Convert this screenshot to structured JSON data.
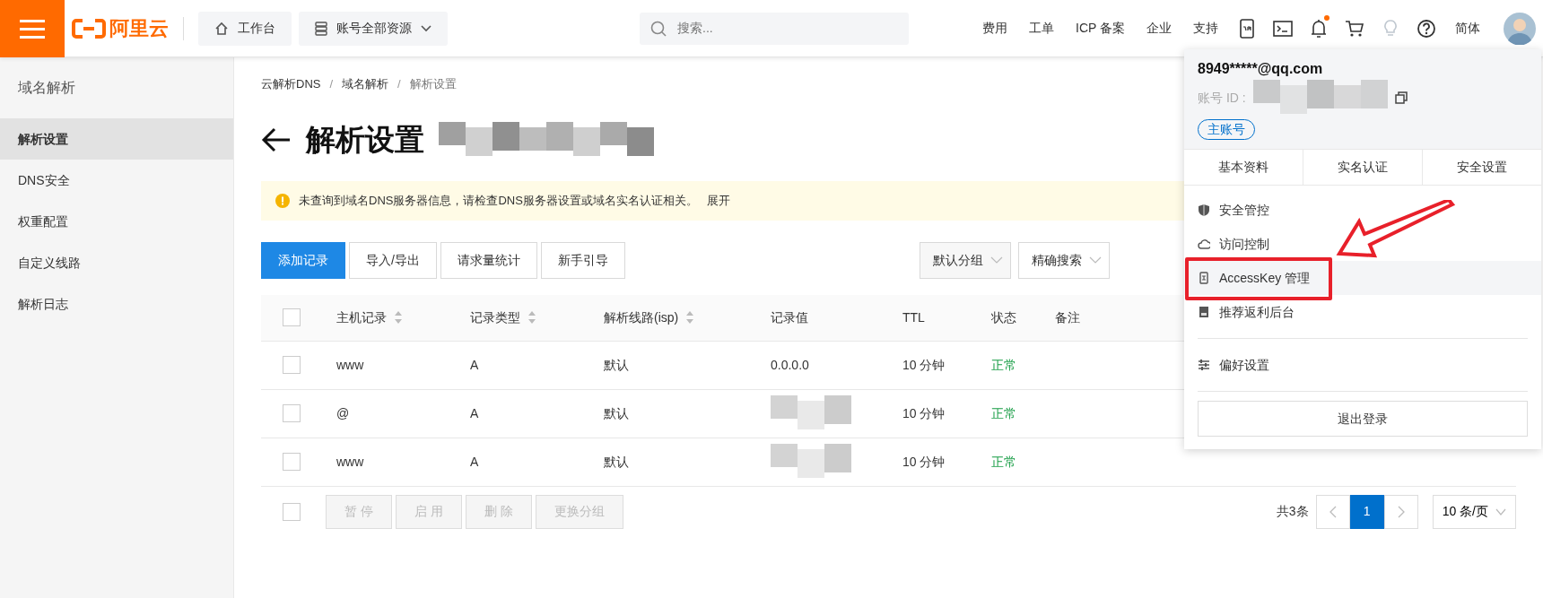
{
  "topbar": {
    "logo_text": "阿里云",
    "workbench": "工作台",
    "resources": "账号全部资源",
    "search_placeholder": "搜索...",
    "links": [
      "费用",
      "工单",
      "ICP 备案",
      "企业",
      "支持"
    ],
    "icons": [
      {
        "kind": "app",
        "dot": false,
        "dimmed": false
      },
      {
        "kind": "terminal",
        "dot": false,
        "dimmed": false
      },
      {
        "kind": "bell",
        "dot": true,
        "dimmed": false
      },
      {
        "kind": "cart",
        "dot": false,
        "dimmed": false
      },
      {
        "kind": "bulb",
        "dot": false,
        "dimmed": true
      },
      {
        "kind": "help",
        "dot": false,
        "dimmed": false
      }
    ],
    "language": "简体"
  },
  "sidebar": {
    "title": "域名解析",
    "items": [
      {
        "label": "解析设置",
        "selected": true
      },
      {
        "label": "DNS安全",
        "selected": false
      },
      {
        "label": "权重配置",
        "selected": false
      },
      {
        "label": "自定义线路",
        "selected": false
      },
      {
        "label": "解析日志",
        "selected": false
      }
    ]
  },
  "breadcrumb": {
    "items": [
      "云解析DNS",
      "域名解析",
      "解析设置"
    ],
    "separators": [
      "/",
      "/"
    ]
  },
  "page_title": {
    "text": "解析设置",
    "redacted": true
  },
  "alert": {
    "text": "未查询到域名DNS服务器信息，请检查DNS服务器设置或域名实名认证相关。",
    "link": "展开"
  },
  "toolbar": {
    "buttons": [
      {
        "label": "添加记录",
        "primary": true
      },
      {
        "label": "导入/导出",
        "primary": false
      },
      {
        "label": "请求量统计",
        "primary": false
      },
      {
        "label": "新手引导",
        "primary": false
      }
    ],
    "filters": [
      {
        "label": "默认分组",
        "shaded": true
      },
      {
        "label": "精确搜索",
        "shaded": false
      }
    ]
  },
  "table": {
    "select_all": {
      "checked": false
    },
    "columns": [
      {
        "label": "主机记录",
        "sortable": true
      },
      {
        "label": "记录类型",
        "sortable": true
      },
      {
        "label": "解析线路(isp)",
        "sortable": true
      },
      {
        "label": "记录值",
        "sortable": false
      },
      {
        "label": "TTL",
        "sortable": false
      },
      {
        "label": "状态",
        "sortable": false
      },
      {
        "label": "备注",
        "sortable": false
      }
    ],
    "rows": [
      {
        "checked": false,
        "host": "www",
        "type": "A",
        "line": "默认",
        "value": "0.0.0.0",
        "redacted": false,
        "ttl": "10 分钟",
        "status": "正常"
      },
      {
        "checked": false,
        "host": "@",
        "type": "A",
        "line": "默认",
        "redacted": true,
        "ttl": "10 分钟",
        "status": "正常"
      },
      {
        "checked": false,
        "host": "www",
        "type": "A",
        "line": "默认",
        "redacted": true,
        "ttl": "10 分钟",
        "status": "正常"
      }
    ],
    "bulk": {
      "checked": false,
      "actions": [
        {
          "label": "暂 停",
          "disabled": true
        },
        {
          "label": "启 用",
          "disabled": true
        },
        {
          "label": "删 除",
          "disabled": true
        },
        {
          "label": "更换分组",
          "disabled": true
        }
      ]
    }
  },
  "pagination": {
    "total": "共3条",
    "pages": [
      {
        "label": "1",
        "selected": true
      }
    ],
    "page_size": "10 条/页"
  },
  "account_menu": {
    "email": "8949*****@qq.com",
    "id_label": "账号 ID :",
    "id_redacted": true,
    "badge": "主账号",
    "tabs": [
      "基本资料",
      "实名认证",
      "安全设置"
    ],
    "items": [
      {
        "kind": "shield",
        "label": "安全管控",
        "highlighted": false,
        "annotated": false
      },
      {
        "kind": "cloud",
        "label": "访问控制",
        "highlighted": false,
        "annotated": false
      },
      {
        "kind": "key",
        "label": "AccessKey 管理",
        "highlighted": true,
        "annotated": true
      },
      {
        "kind": "card",
        "label": "推荐返利后台",
        "highlighted": false,
        "annotated": false
      },
      {
        "kind": "divider"
      },
      {
        "kind": "sliders",
        "label": "偏好设置",
        "highlighted": false,
        "annotated": false
      }
    ],
    "logout": "退出登录"
  }
}
